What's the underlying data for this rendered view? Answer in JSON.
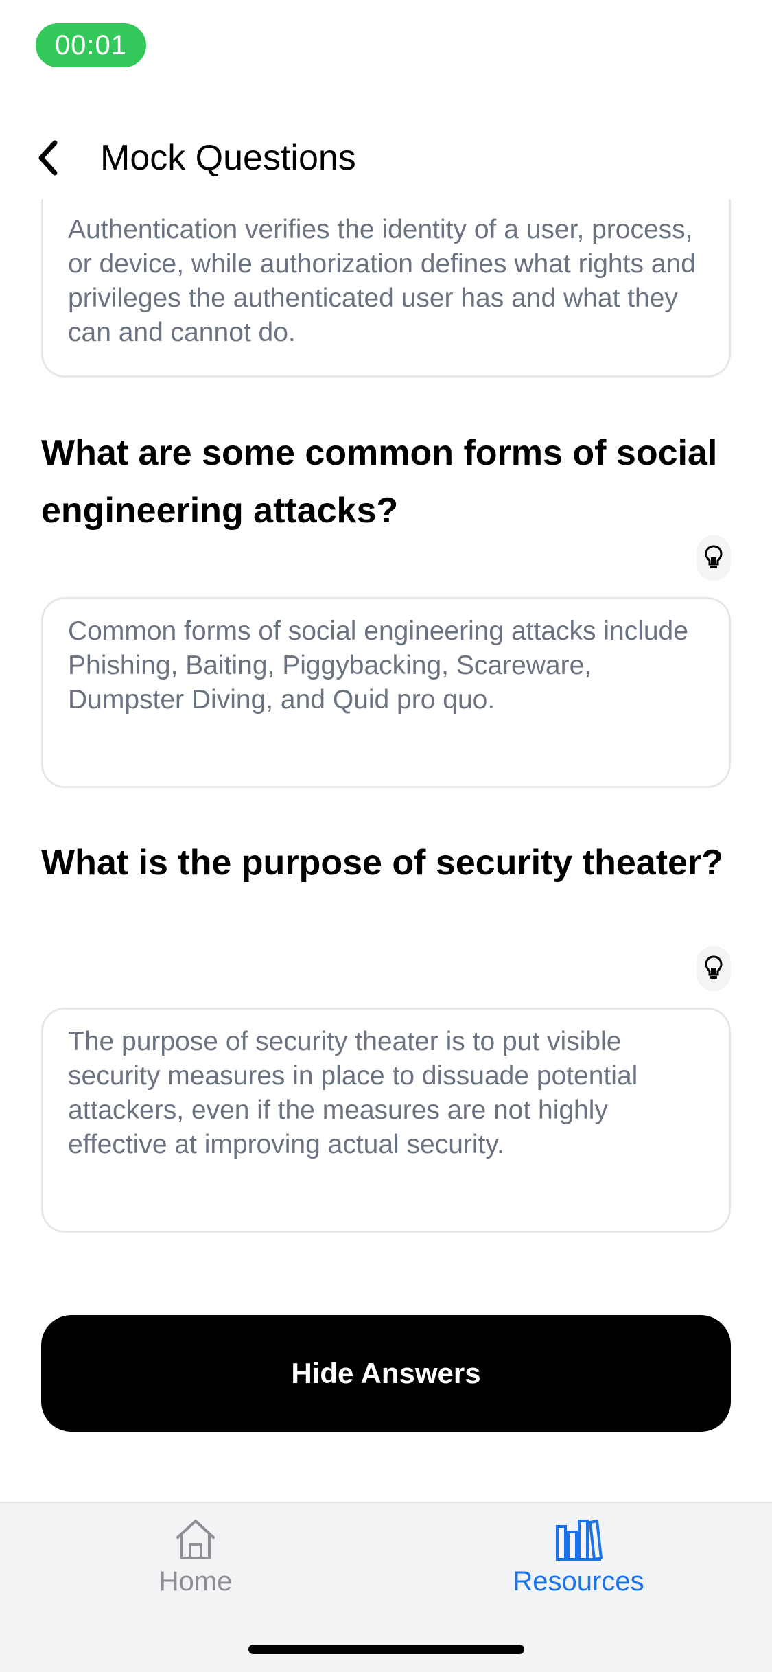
{
  "status": {
    "timer": "00:01"
  },
  "nav": {
    "title": "Mock Questions",
    "back_icon": "chevron-left-icon"
  },
  "items": [
    {
      "answer": "Authentication verifies the identity of a user, process, or device, while authorization defines what rights and privileges the authenticated user has and what they can and cannot do."
    },
    {
      "question": "What are some common forms of social engineering attacks?",
      "hint_icon": "lightbulb-icon",
      "answer": "Common forms of social engineering attacks include Phishing, Baiting, Piggybacking, Scareware, Dumpster Diving, and Quid pro quo."
    },
    {
      "question": "What is the purpose of security theater?",
      "hint_icon": "lightbulb-icon",
      "answer": "The purpose of security theater is to put visible security measures in place to dissuade potential attackers, even if the measures are not highly effective at improving actual security."
    }
  ],
  "actions": {
    "hide_answers_label": "Hide Answers"
  },
  "tabs": [
    {
      "label": "Home",
      "icon": "home-icon",
      "active": false
    },
    {
      "label": "Resources",
      "icon": "books-icon",
      "active": true
    }
  ],
  "colors": {
    "accent": "#1a73e8",
    "timer_bg": "#34c759",
    "inactive": "#8e8e93"
  }
}
